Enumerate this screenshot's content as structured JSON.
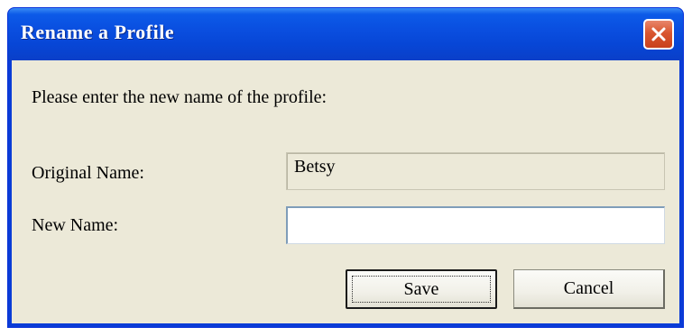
{
  "window": {
    "title": "Rename a Profile",
    "close_icon": "close-x-icon"
  },
  "dialog": {
    "prompt": "Please enter the new name of the profile:",
    "original_name_label": "Original Name:",
    "original_name_value": "Betsy",
    "new_name_label": "New Name:",
    "new_name_value": "",
    "save_label": "Save",
    "cancel_label": "Cancel"
  },
  "colors": {
    "titlebar": "#0a4fe0",
    "client_background": "#ece9d8",
    "close_button": "#d9562f"
  }
}
